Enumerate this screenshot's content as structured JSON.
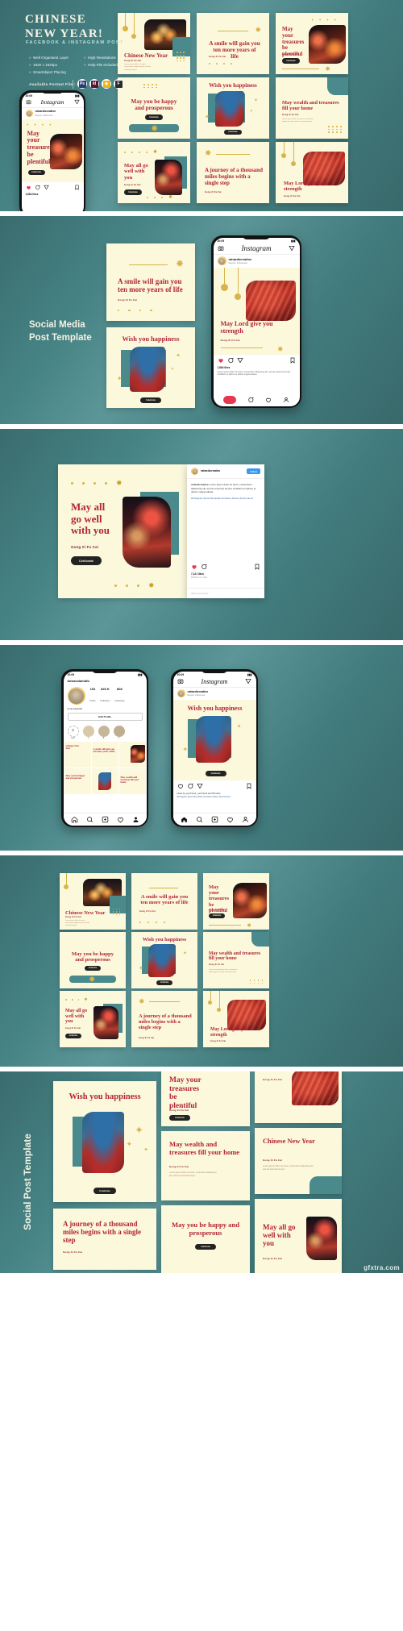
{
  "brand": {
    "title_line1": "CHINESE",
    "title_line2": "NEW YEAR!",
    "subtitle": "FACEBOOK & INSTAGRAM POST",
    "features": [
      "Well Organised Layer",
      "High Resolutions",
      "1920 x 1920px",
      "Help File Included",
      "Smartobject Placing"
    ],
    "format_label": "Available Format File :",
    "format_icons": [
      {
        "name": "photoshop-icon",
        "letters": "Ps",
        "color": "#2a3f7a"
      },
      {
        "name": "indesign-icon",
        "letters": "Id",
        "color": "#5c1338"
      },
      {
        "name": "sketch-icon",
        "letters": "◆",
        "color": "#f2b21c"
      },
      {
        "name": "figma-icon",
        "letters": "F",
        "color": "#2b2b2b"
      }
    ]
  },
  "headline_section2": "Social Media\nPost Template",
  "headline_section6": "Social Post Template",
  "colors": {
    "teal": "#4a8a8c",
    "cream": "#fbf8dc",
    "maroon": "#b3243a",
    "gold": "#c9a227",
    "dark": "#232323"
  },
  "common": {
    "gong_xi_fa_cai": "Gong Xi Fa Cai",
    "celebrate": "Celebrate",
    "lorem": "Lorem ipsum dolor sit amet, consectetur adipiscing elit, sed do eiusmod tempor."
  },
  "posts": [
    {
      "id": "chinese-new-year",
      "title": "Chinese New Year",
      "sub": "Gong Xi Fa Cai",
      "body": "Lorem ipsum dolor sit amet, consectetur adipiscing elit, sed do eiusmod tempor.",
      "photo": "temple"
    },
    {
      "id": "a-smile",
      "title": "A smile will gain you ten more years of life",
      "sub": "Gong Xi Fa Cai",
      "body": "",
      "photo": "none"
    },
    {
      "id": "may-your-treasures",
      "title": "May your treasures be plentiful",
      "sub": "Gong Xi Fa Cai",
      "body": "",
      "photo": "lantern",
      "button": "Celebrate"
    },
    {
      "id": "may-you-be-happy",
      "title": "May you be happy and prosperous",
      "sub": "Gong Xi Fa Cai",
      "body": "",
      "photo": "none",
      "button": "Celebrate"
    },
    {
      "id": "wish-you-happiness",
      "title": "Wish you happiness",
      "sub": "Gong Xi Fa Cai",
      "body": "",
      "photo": "girl",
      "button": "Celebrate"
    },
    {
      "id": "may-wealth",
      "title": "May wealth and treasures fill your home",
      "sub": "Gong Xi Fa Cai",
      "body": "Lorem ipsum dolor sit amet, consectetur adipiscing elit, sed do eiusmod tempor.",
      "photo": "none"
    },
    {
      "id": "may-all-go-well",
      "title": "May all go well with you",
      "sub": "Gong Xi Fa Cai",
      "body": "",
      "photo": "street",
      "button": "Celebrate"
    },
    {
      "id": "a-journey",
      "title": "A journey of a thousand miles begins with a single step",
      "sub": "Gong Xi Fa Cai",
      "body": "",
      "photo": "none"
    },
    {
      "id": "may-lord-give",
      "title": "May Lord give you strength",
      "sub": "Gong Xi Fa Cai",
      "body": "",
      "photo": "redlanterns"
    }
  ],
  "instagram": {
    "status_time": "20:09",
    "logo": "Instagram",
    "username": "rahardicreative",
    "user_sub": "Depok, Indonesia",
    "likes": "1,884 likes",
    "likes_detail": "7,121 likes",
    "date": "MARCH 17, 2021",
    "follow_label": "Follow",
    "add_comment": "Add a comment...",
    "caption_user": "rahardicreative",
    "caption_text": "Lorem ipsum dolor sit amet, consectetur adipiscing elit, sed do eiusmod tempor incididunt ut labore et dolore magna aliqua.",
    "hashtags": "#instagram #post #template #creative #clean #promotions",
    "liked_by": "Liked by yourfriend, yourfriend and 58 other",
    "tabs_icons": [
      "home-icon",
      "search-icon",
      "add-post-icon",
      "heart-icon",
      "profile-icon"
    ],
    "profile": {
      "name": "bmarsolainblb",
      "handle": "bmarsolainblb",
      "posts_count": "192",
      "posts_label": "Posts",
      "followers_count": "840 K",
      "followers_label": "Followers",
      "following_count": "808",
      "following_label": "Following",
      "edit_profile": "Edit Profile",
      "highlights": [
        "New",
        "A",
        "B",
        "C"
      ]
    }
  },
  "watermark": "gfxtra.com"
}
